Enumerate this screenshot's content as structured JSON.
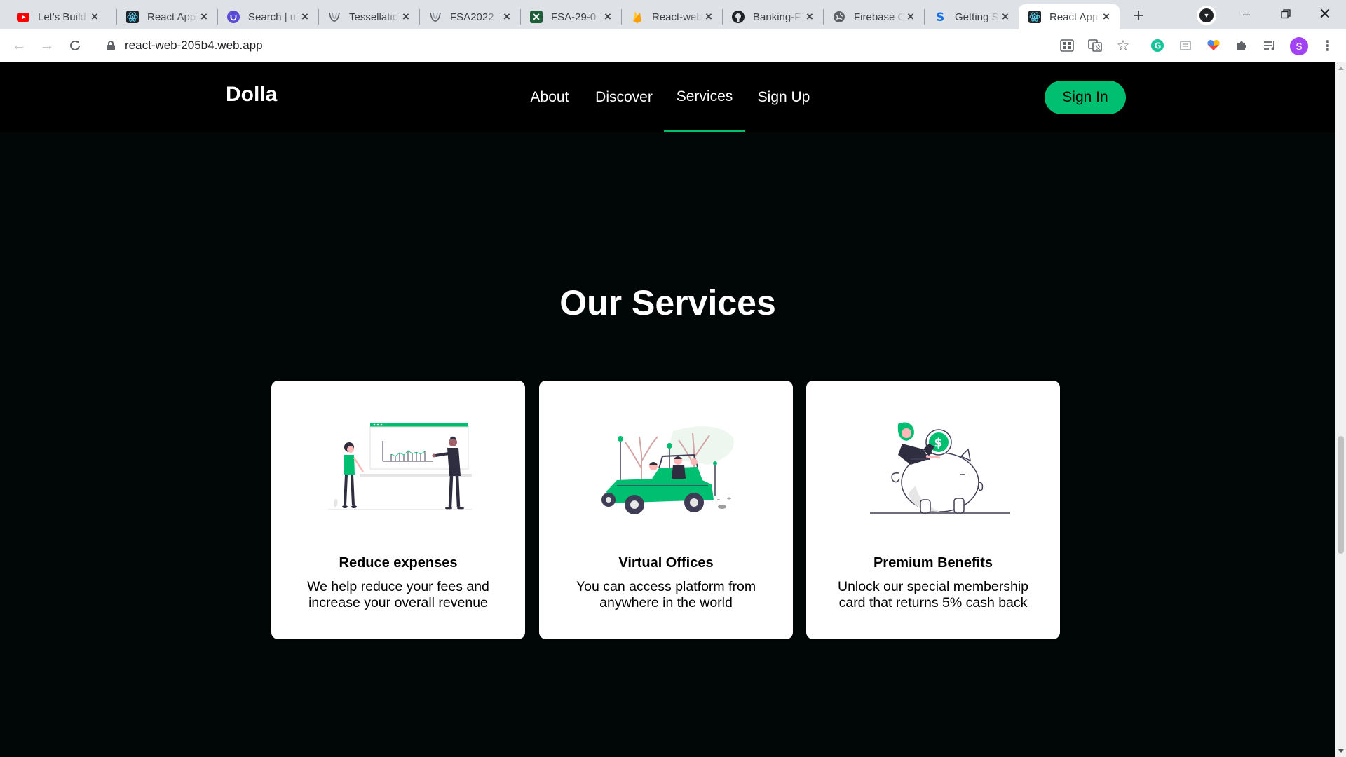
{
  "browser": {
    "tabs": [
      {
        "title": "Let's Build",
        "favicon": "youtube-icon",
        "color": "#ff0000",
        "active": false
      },
      {
        "title": "React App",
        "favicon": "react-icon",
        "color": "#3c4043",
        "active": false
      },
      {
        "title": "Search | u",
        "favicon": "udemy-icon",
        "color": "#5a4bd6",
        "active": false
      },
      {
        "title": "Tessellatio",
        "favicon": "tessellation-icon",
        "color": "#3c4043",
        "active": false
      },
      {
        "title": "FSA2022",
        "favicon": "tessellation-icon",
        "color": "#3c4043",
        "active": false
      },
      {
        "title": "FSA-29-0",
        "favicon": "spreadsheet-icon",
        "color": "#1e5f3a",
        "active": false
      },
      {
        "title": "React-web",
        "favicon": "firebase-icon",
        "color": "#ffa000",
        "active": false
      },
      {
        "title": "Banking-F",
        "favicon": "github-icon",
        "color": "#202124",
        "active": false
      },
      {
        "title": "Firebase C",
        "favicon": "globe-icon",
        "color": "#5f6368",
        "active": false
      },
      {
        "title": "Getting St",
        "favicon": "styled-s-icon",
        "color": "#1a73e8",
        "active": false
      },
      {
        "title": "React App",
        "favicon": "react-icon",
        "color": "#3c4043",
        "active": true
      }
    ],
    "url": "react-web-205b4.web.app",
    "profile_initial": "S"
  },
  "site": {
    "logo": "Dolla",
    "nav": [
      {
        "label": "About",
        "active": false
      },
      {
        "label": "Discover",
        "active": false
      },
      {
        "label": "Services",
        "active": true
      },
      {
        "label": "Sign Up",
        "active": false
      }
    ],
    "signin_label": "Sign In",
    "accent": "#01bf71",
    "section_title": "Our Services",
    "services": [
      {
        "title": "Reduce expenses",
        "text": "We help reduce your fees and increase your overall revenue",
        "illustration": "presentation-chart-illustration"
      },
      {
        "title": "Virtual Offices",
        "text": "You can access platform from anywhere in the world",
        "illustration": "green-jeep-illustration"
      },
      {
        "title": "Premium Benefits",
        "text": "Unlock our special membership card that returns 5% cash back",
        "illustration": "piggy-bank-illustration"
      }
    ]
  }
}
